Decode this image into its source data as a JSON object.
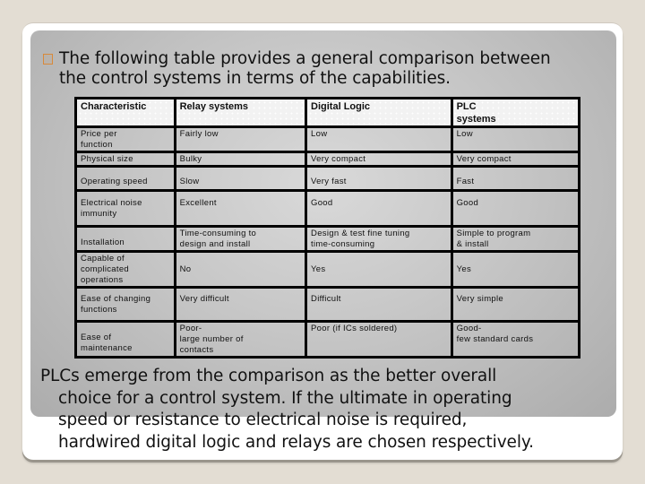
{
  "intro": {
    "bullet_icon": "hollow-square-bullet",
    "lines": [
      "The following table provides a general comparison between",
      "the control systems in terms of the capabilities."
    ]
  },
  "table": {
    "headers": [
      "Characteristic",
      "Relay systems",
      "Digital Logic",
      "PLC\nsystems"
    ],
    "header_lines": {
      "plc": [
        "PLC",
        "systems"
      ]
    },
    "rows": [
      {
        "characteristic": [
          "Price per",
          "function"
        ],
        "relay": [
          "Fairly low"
        ],
        "digital": [
          "Low"
        ],
        "plc": [
          "Low"
        ]
      },
      {
        "characteristic": [
          "Physical size"
        ],
        "relay": [
          "Bulky"
        ],
        "digital": [
          "Very compact"
        ],
        "plc": [
          "Very compact"
        ]
      },
      {
        "characteristic": [
          "Operating speed"
        ],
        "relay": [
          "Slow"
        ],
        "digital": [
          "Very fast"
        ],
        "plc": [
          "Fast"
        ]
      },
      {
        "characteristic": [
          "Electrical noise",
          "immunity"
        ],
        "relay": [
          "Excellent"
        ],
        "digital": [
          "Good"
        ],
        "plc": [
          "Good"
        ]
      },
      {
        "characteristic": [
          "Installation"
        ],
        "relay": [
          "Time-consuming to",
          "design and install"
        ],
        "digital": [
          "Design & test fine tuning",
          "time-consuming"
        ],
        "plc": [
          "Simple to program",
          "& install"
        ]
      },
      {
        "characteristic": [
          "Capable of",
          "complicated",
          "operations"
        ],
        "relay": [
          "No"
        ],
        "digital": [
          "Yes"
        ],
        "plc": [
          "Yes"
        ]
      },
      {
        "characteristic": [
          "Ease of changing",
          "functions"
        ],
        "relay": [
          "Very difficult"
        ],
        "digital": [
          "Difficult"
        ],
        "plc": [
          "Very simple"
        ]
      },
      {
        "characteristic": [
          "Ease of",
          "maintenance"
        ],
        "relay": [
          "Poor-",
          "large number of",
          "contacts"
        ],
        "digital": [
          "Poor (if ICs soldered)"
        ],
        "plc": [
          "Good-",
          "few standard cards"
        ]
      }
    ]
  },
  "conclusion": {
    "lines": [
      "PLCs emerge from the comparison as the better overall",
      "choice for a control system. If the ultimate in operating",
      "speed or resistance to electrical noise is required,",
      "hardwired digital logic and relays are chosen respectively."
    ]
  },
  "colors": {
    "background": "#e3ddd3",
    "slide": "#ffffff",
    "panel": "#c6c6c6",
    "bullet_accent": "#d8893a",
    "table_border": "#000000"
  }
}
